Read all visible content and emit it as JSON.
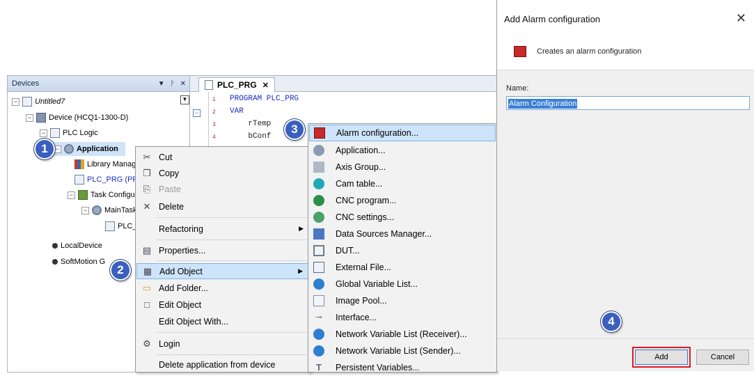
{
  "devices_panel": {
    "title": "Devices",
    "pin": "╴ ▣",
    "close": "✕",
    "tree": [
      {
        "label": "Untitled7"
      },
      {
        "label": "Device (HCQ1-1300-D)"
      },
      {
        "label": "PLC Logic"
      },
      {
        "label": "Application"
      },
      {
        "label": "Library Manag"
      },
      {
        "label": "PLC_PRG (PR"
      },
      {
        "label": "Task Configur"
      },
      {
        "label": "MainTask"
      },
      {
        "label": "PLC_I"
      },
      {
        "label": "LocalDevice"
      },
      {
        "label": "SoftMotion G"
      }
    ]
  },
  "editor": {
    "tab_label": "PLC_PRG",
    "tab_close": "✕",
    "lines": [
      {
        "num": "1",
        "text": "PROGRAM PLC_PRG"
      },
      {
        "num": "2",
        "text": "VAR"
      },
      {
        "num": "3",
        "text": "    rTemp"
      },
      {
        "num": "4",
        "text": "    bConf"
      }
    ]
  },
  "context_menu": {
    "items": [
      {
        "label": "Cut",
        "icon": "✂"
      },
      {
        "label": "Copy",
        "icon": "❐"
      },
      {
        "label": "Paste",
        "icon": "⎘"
      },
      {
        "label": "Delete",
        "icon": "✕"
      },
      {
        "label": "Refactoring",
        "icon": ""
      },
      {
        "label": "Properties...",
        "icon": "▤"
      },
      {
        "label": "Add Object",
        "icon": "▦"
      },
      {
        "label": "Add Folder...",
        "icon": "▭"
      },
      {
        "label": "Edit Object",
        "icon": "□"
      },
      {
        "label": "Edit Object With...",
        "icon": ""
      },
      {
        "label": "Login",
        "icon": "⚙"
      },
      {
        "label": "Delete application from device",
        "icon": ""
      }
    ],
    "arrow": "▶"
  },
  "submenu": {
    "items": [
      {
        "label": "Alarm configuration...",
        "color": "#c62a2a"
      },
      {
        "label": "Application...",
        "color": "#8a9ab3"
      },
      {
        "label": "Axis Group...",
        "color": "#b0b8c6"
      },
      {
        "label": "Cam table...",
        "color": "#23a8b8"
      },
      {
        "label": "CNC program...",
        "color": "#2c8e4a"
      },
      {
        "label": "CNC settings...",
        "color": "#4aa066"
      },
      {
        "label": "Data Sources Manager...",
        "color": "#4b78c2"
      },
      {
        "label": "DUT...",
        "color": "#6b7b94"
      },
      {
        "label": "External File...",
        "color": "#5a6b88"
      },
      {
        "label": "Global Variable List...",
        "color": "#2f7fd0"
      },
      {
        "label": "Image Pool...",
        "color": "#7c8ba3"
      },
      {
        "label": "Interface...",
        "color": "#55657f"
      },
      {
        "label": "Network Variable List (Receiver)...",
        "color": "#2f7fd0"
      },
      {
        "label": "Network Variable List (Sender)...",
        "color": "#2f7fd0"
      },
      {
        "label": "Persistent Variables...",
        "color": "#55657f"
      }
    ]
  },
  "dialog": {
    "title": "Add Alarm configuration",
    "close": "✕",
    "description": "Creates an alarm configuration",
    "name_label": "Name:",
    "name_value": "Alarm Configuration",
    "add_label": "Add",
    "cancel_label": "Cancel"
  },
  "badges": [
    "1",
    "2",
    "3",
    "4"
  ],
  "colors": {
    "badge": "#3a5fbe",
    "highlight_border": "#e0191d",
    "selection": "#cde4fa"
  }
}
